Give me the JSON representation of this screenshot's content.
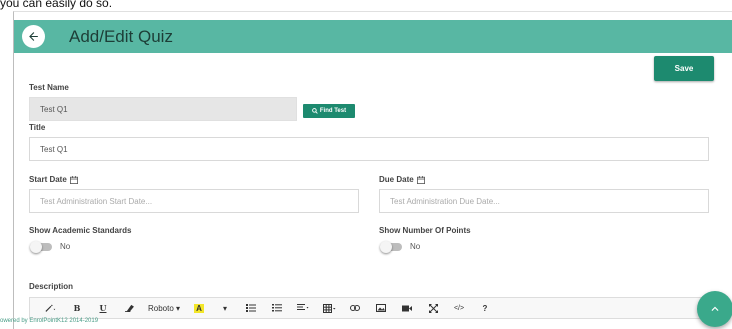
{
  "caption": "you can easily do so.",
  "header": {
    "title": "Add/Edit Quiz"
  },
  "toolbar": {
    "save_label": "Save"
  },
  "form": {
    "test_name": {
      "label": "Test Name",
      "value": "Test Q1",
      "find_label": "Find Test"
    },
    "title": {
      "label": "Title",
      "value": "Test Q1"
    },
    "start_date": {
      "label": "Start Date",
      "placeholder": "Test Administration Start Date..."
    },
    "due_date": {
      "label": "Due Date",
      "placeholder": "Test Administration Due Date..."
    },
    "show_standards": {
      "label": "Show Academic Standards",
      "state": "No"
    },
    "show_points": {
      "label": "Show Number Of Points",
      "state": "No"
    },
    "description": {
      "label": "Description"
    }
  },
  "editor": {
    "font_name": "Roboto",
    "bold": "B",
    "underline": "U",
    "color_letter": "A",
    "code": "</>",
    "help": "?"
  },
  "footer": {
    "text": "owered by EnrolPointK12 2014-2019"
  },
  "colors": {
    "header": "#58b7a3",
    "button": "#1d8a6f",
    "fab": "#3aa98b"
  }
}
